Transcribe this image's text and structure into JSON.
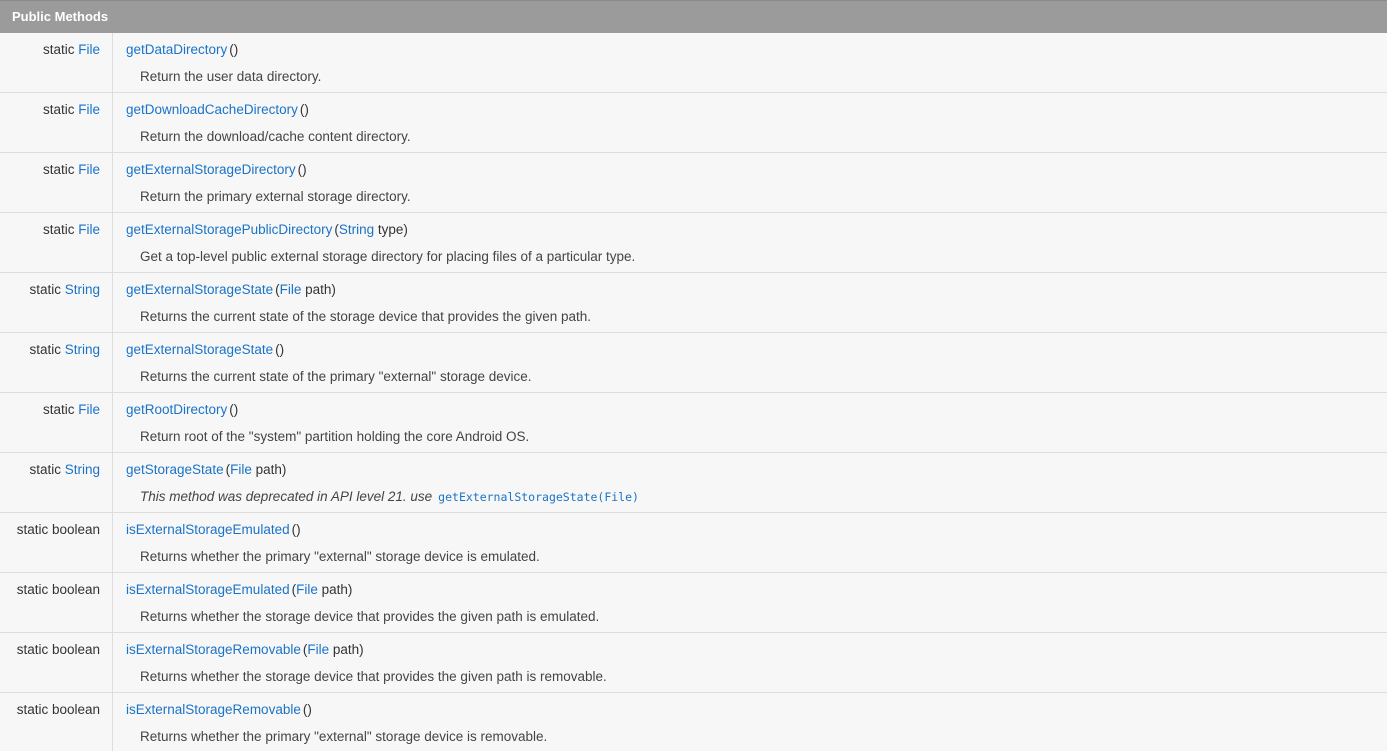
{
  "header": {
    "title": "Public Methods"
  },
  "colors": {
    "header_bg": "#9b9b9b",
    "row_bg": "#f7f7f7",
    "link": "#1a73c8",
    "text": "#333333"
  },
  "methods": [
    {
      "modifier": "static",
      "type": "File",
      "type_is_link": true,
      "name": "getDataDirectory",
      "open": "(",
      "params": [],
      "close": ")",
      "description": "Return the user data directory."
    },
    {
      "modifier": "static",
      "type": "File",
      "type_is_link": true,
      "name": "getDownloadCacheDirectory",
      "open": "(",
      "params": [],
      "close": ")",
      "description": "Return the download/cache content directory."
    },
    {
      "modifier": "static",
      "type": "File",
      "type_is_link": true,
      "name": "getExternalStorageDirectory",
      "open": "(",
      "params": [],
      "close": ")",
      "description": "Return the primary external storage directory."
    },
    {
      "modifier": "static",
      "type": "File",
      "type_is_link": true,
      "name": "getExternalStoragePublicDirectory",
      "open": "(",
      "params": [
        {
          "type": "String",
          "name": " type"
        }
      ],
      "close": ")",
      "description": "Get a top-level public external storage directory for placing files of a particular type."
    },
    {
      "modifier": "static",
      "type": "String",
      "type_is_link": true,
      "name": "getExternalStorageState",
      "open": "(",
      "params": [
        {
          "type": "File",
          "name": " path"
        }
      ],
      "close": ")",
      "description": "Returns the current state of the storage device that provides the given path."
    },
    {
      "modifier": "static",
      "type": "String",
      "type_is_link": true,
      "name": "getExternalStorageState",
      "open": "(",
      "params": [],
      "close": ")",
      "description": "Returns the current state of the primary \"external\" storage device."
    },
    {
      "modifier": "static",
      "type": "File",
      "type_is_link": true,
      "name": "getRootDirectory",
      "open": "(",
      "params": [],
      "close": ")",
      "description": "Return root of the \"system\" partition holding the core Android OS."
    },
    {
      "modifier": "static",
      "type": "String",
      "type_is_link": true,
      "name": "getStorageState",
      "open": "(",
      "params": [
        {
          "type": "File",
          "name": " path"
        }
      ],
      "close": ")",
      "deprecated": true,
      "description": "This method was deprecated in API level 21. use",
      "deprecated_link": "getExternalStorageState(File)"
    },
    {
      "modifier": "static boolean",
      "type": "",
      "type_is_link": false,
      "name": "isExternalStorageEmulated",
      "open": "(",
      "params": [],
      "close": ")",
      "description": "Returns whether the primary \"external\" storage device is emulated."
    },
    {
      "modifier": "static boolean",
      "type": "",
      "type_is_link": false,
      "name": "isExternalStorageEmulated",
      "open": "(",
      "params": [
        {
          "type": "File",
          "name": " path"
        }
      ],
      "close": ")",
      "description": "Returns whether the storage device that provides the given path is emulated."
    },
    {
      "modifier": "static boolean",
      "type": "",
      "type_is_link": false,
      "name": "isExternalStorageRemovable",
      "open": "(",
      "params": [
        {
          "type": "File",
          "name": " path"
        }
      ],
      "close": ")",
      "description": "Returns whether the storage device that provides the given path is removable."
    },
    {
      "modifier": "static boolean",
      "type": "",
      "type_is_link": false,
      "name": "isExternalStorageRemovable",
      "open": "(",
      "params": [],
      "close": ")",
      "description": "Returns whether the primary \"external\" storage device is removable."
    }
  ]
}
